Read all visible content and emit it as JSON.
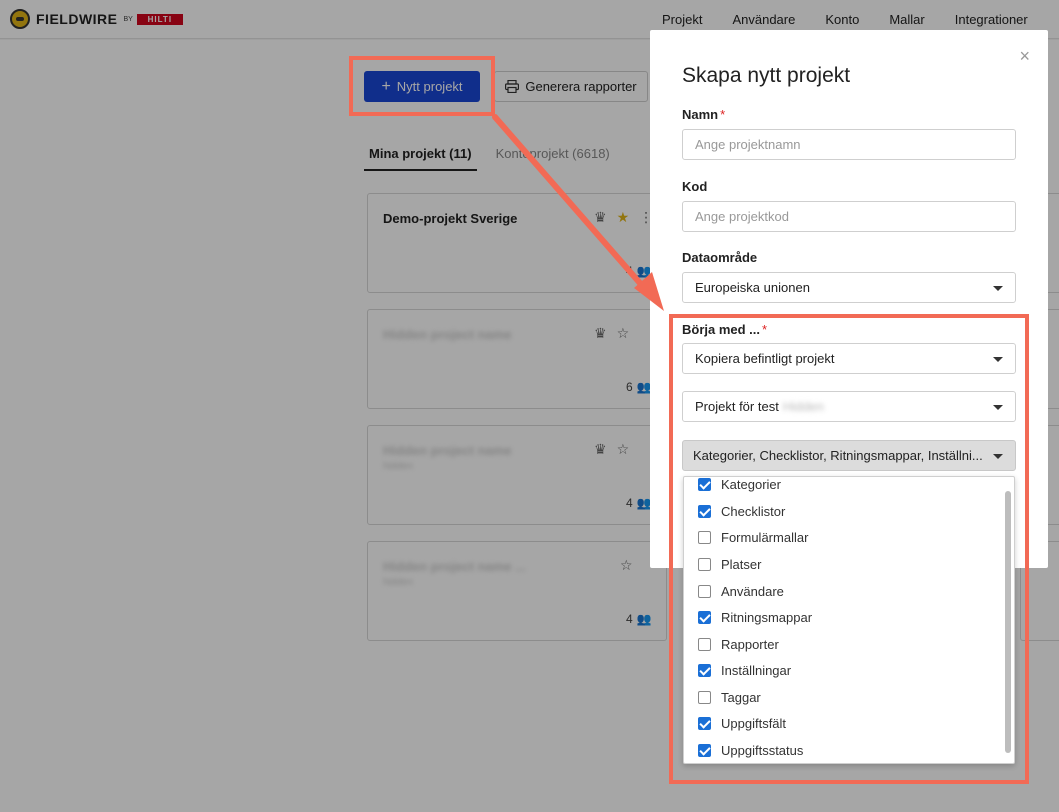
{
  "topbar": {
    "logo_text": "FIELDWIRE",
    "logo_by": "BY",
    "logo_hilti": "HILTI",
    "nav": [
      "Projekt",
      "Användare",
      "Konto",
      "Mallar",
      "Integrationer"
    ]
  },
  "toolbar": {
    "new_project_label": "Nytt projekt",
    "reports_label": "Generera rapporter"
  },
  "tabs": [
    {
      "label": "Mina projekt (11)",
      "active": true
    },
    {
      "label": "Kontoprojekt (6618)",
      "active": false
    }
  ],
  "cards": [
    {
      "title": "Demo-projekt Sverige",
      "users": "4"
    },
    {
      "title": "Hidden project name",
      "users": "6"
    },
    {
      "title": "Hidden project name",
      "sub": "hidden",
      "users": "4"
    },
    {
      "title": "Hidden project name ...",
      "sub": "hidden",
      "users": "4"
    }
  ],
  "modal": {
    "title": "Skapa nytt projekt",
    "close": "×",
    "name_label": "Namn",
    "name_placeholder": "Ange projektnamn",
    "code_label": "Kod",
    "code_placeholder": "Ange projektkod",
    "region_label": "Dataområde",
    "region_value": "Europeiska unionen",
    "start_label": "Börja med ...",
    "start_value": "Kopiera befintligt projekt",
    "source_value": "Projekt för test",
    "source_hidden": "Hidden",
    "copy_value": "Kategorier, Checklistor, Ritningsmappar, Inställni..."
  },
  "dropdown": {
    "items": [
      {
        "label": "Kategorier",
        "checked": true
      },
      {
        "label": "Checklistor",
        "checked": true
      },
      {
        "label": "Formulärmallar",
        "checked": false
      },
      {
        "label": "Platser",
        "checked": false
      },
      {
        "label": "Användare",
        "checked": false
      },
      {
        "label": "Ritningsmappar",
        "checked": true
      },
      {
        "label": "Rapporter",
        "checked": false
      },
      {
        "label": "Inställningar",
        "checked": true
      },
      {
        "label": "Taggar",
        "checked": false
      },
      {
        "label": "Uppgiftsfält",
        "checked": true
      },
      {
        "label": "Uppgiftsstatus",
        "checked": true
      }
    ]
  },
  "colors": {
    "primary": "#1a47d6",
    "highlight": "#f26a55",
    "checkbox": "#1a6fd6",
    "star": "#e0b418"
  }
}
